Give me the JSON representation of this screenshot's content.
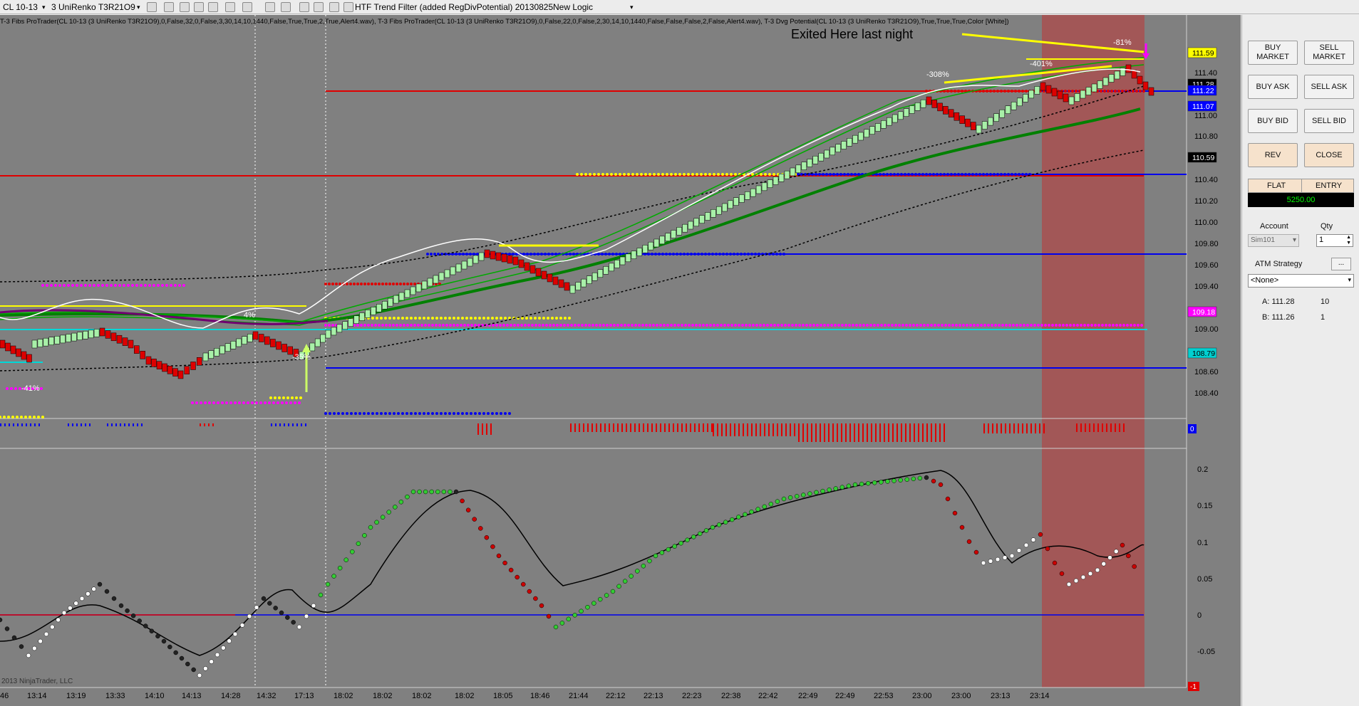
{
  "toolbar": {
    "instrument": "CL 10-13",
    "bar_type": "3 UniRenko T3R21O9",
    "strategy": "HTF Trend Filter (added RegDivPotential) 20130825",
    "template": "New Logic"
  },
  "chart": {
    "indicator_header": "T-3 Fibs ProTrader(CL 10-13 (3 UniRenko T3R21O9),0,False,32,0,False,3,30,14,10,1440,False,True,True,2,True,Alert4.wav), T-3 Fibs ProTrader(CL 10-13 (3 UniRenko T3R21O9),0,False,22,0,False,2,30,14,10,1440,False,False,False,2,False,Alert4.wav), T-3 Dvg Potential(CL 10-13 (3 UniRenko T3R21O9),True,True,True,Color [White])",
    "annotation": "Exited Here last night",
    "copyright": "2013 NinjaTrader, LLC",
    "pct_labels": [
      "-41%",
      "4%",
      "-35%",
      "-308%",
      "-401%",
      "-81%"
    ],
    "price_ticks": [
      "111.40",
      "111.00",
      "110.80",
      "110.40",
      "110.20",
      "110.00",
      "109.80",
      "109.60",
      "109.40",
      "109.00",
      "108.60",
      "108.40"
    ],
    "price_flags": [
      {
        "label": "111.59",
        "color": "#ffff00",
        "text_color": "#000000"
      },
      {
        "label": "111.28",
        "color": "#000000",
        "text_color": "#ffffff"
      },
      {
        "label": "111.22",
        "color": "#0000ff",
        "text_color": "#ffffff"
      },
      {
        "label": "111.07",
        "color": "#0000ff",
        "text_color": "#ffffff"
      },
      {
        "label": "110.59",
        "color": "#000000",
        "text_color": "#ffffff"
      },
      {
        "label": "109.18",
        "color": "#ff00ff",
        "text_color": "#ffffff"
      },
      {
        "label": "108.79",
        "color": "#00d0d0",
        "text_color": "#000000"
      }
    ],
    "mid_flag": "0",
    "osc_ticks": [
      "0.2",
      "0.15",
      "0.1",
      "0.05",
      "0",
      "-0.05"
    ],
    "osc_flag": "-1",
    "time_labels": [
      "13:14",
      "13:19",
      "13:33",
      "14:10",
      "14:13",
      "14:28",
      "14:32",
      "17:13",
      "18:02",
      "18:02",
      "18:02",
      "18:02",
      "18:05",
      "18:46",
      "21:44",
      "22:12",
      "22:13",
      "22:23",
      "22:38",
      "22:42",
      "22:49",
      "22:49",
      "22:53",
      "23:00",
      "23:00",
      "23:13",
      "23:14"
    ],
    "time_left_label": "46"
  },
  "panel": {
    "buy_market": "BUY\nMARKET",
    "sell_market": "SELL\nMARKET",
    "buy_ask": "BUY ASK",
    "sell_ask": "SELL ASK",
    "buy_bid": "BUY BID",
    "sell_bid": "SELL BID",
    "rev": "REV",
    "close": "CLOSE",
    "position": "FLAT",
    "entry": "ENTRY",
    "pnl": "5250.00",
    "account_label": "Account",
    "qty_label": "Qty",
    "account": "Sim101",
    "qty": "1",
    "atm_label": "ATM Strategy",
    "atm_more": "...",
    "atm_value": "<None>",
    "ask_label": "A: 111.28",
    "ask_size": "10",
    "bid_label": "B: 111.26",
    "bid_size": "1"
  }
}
